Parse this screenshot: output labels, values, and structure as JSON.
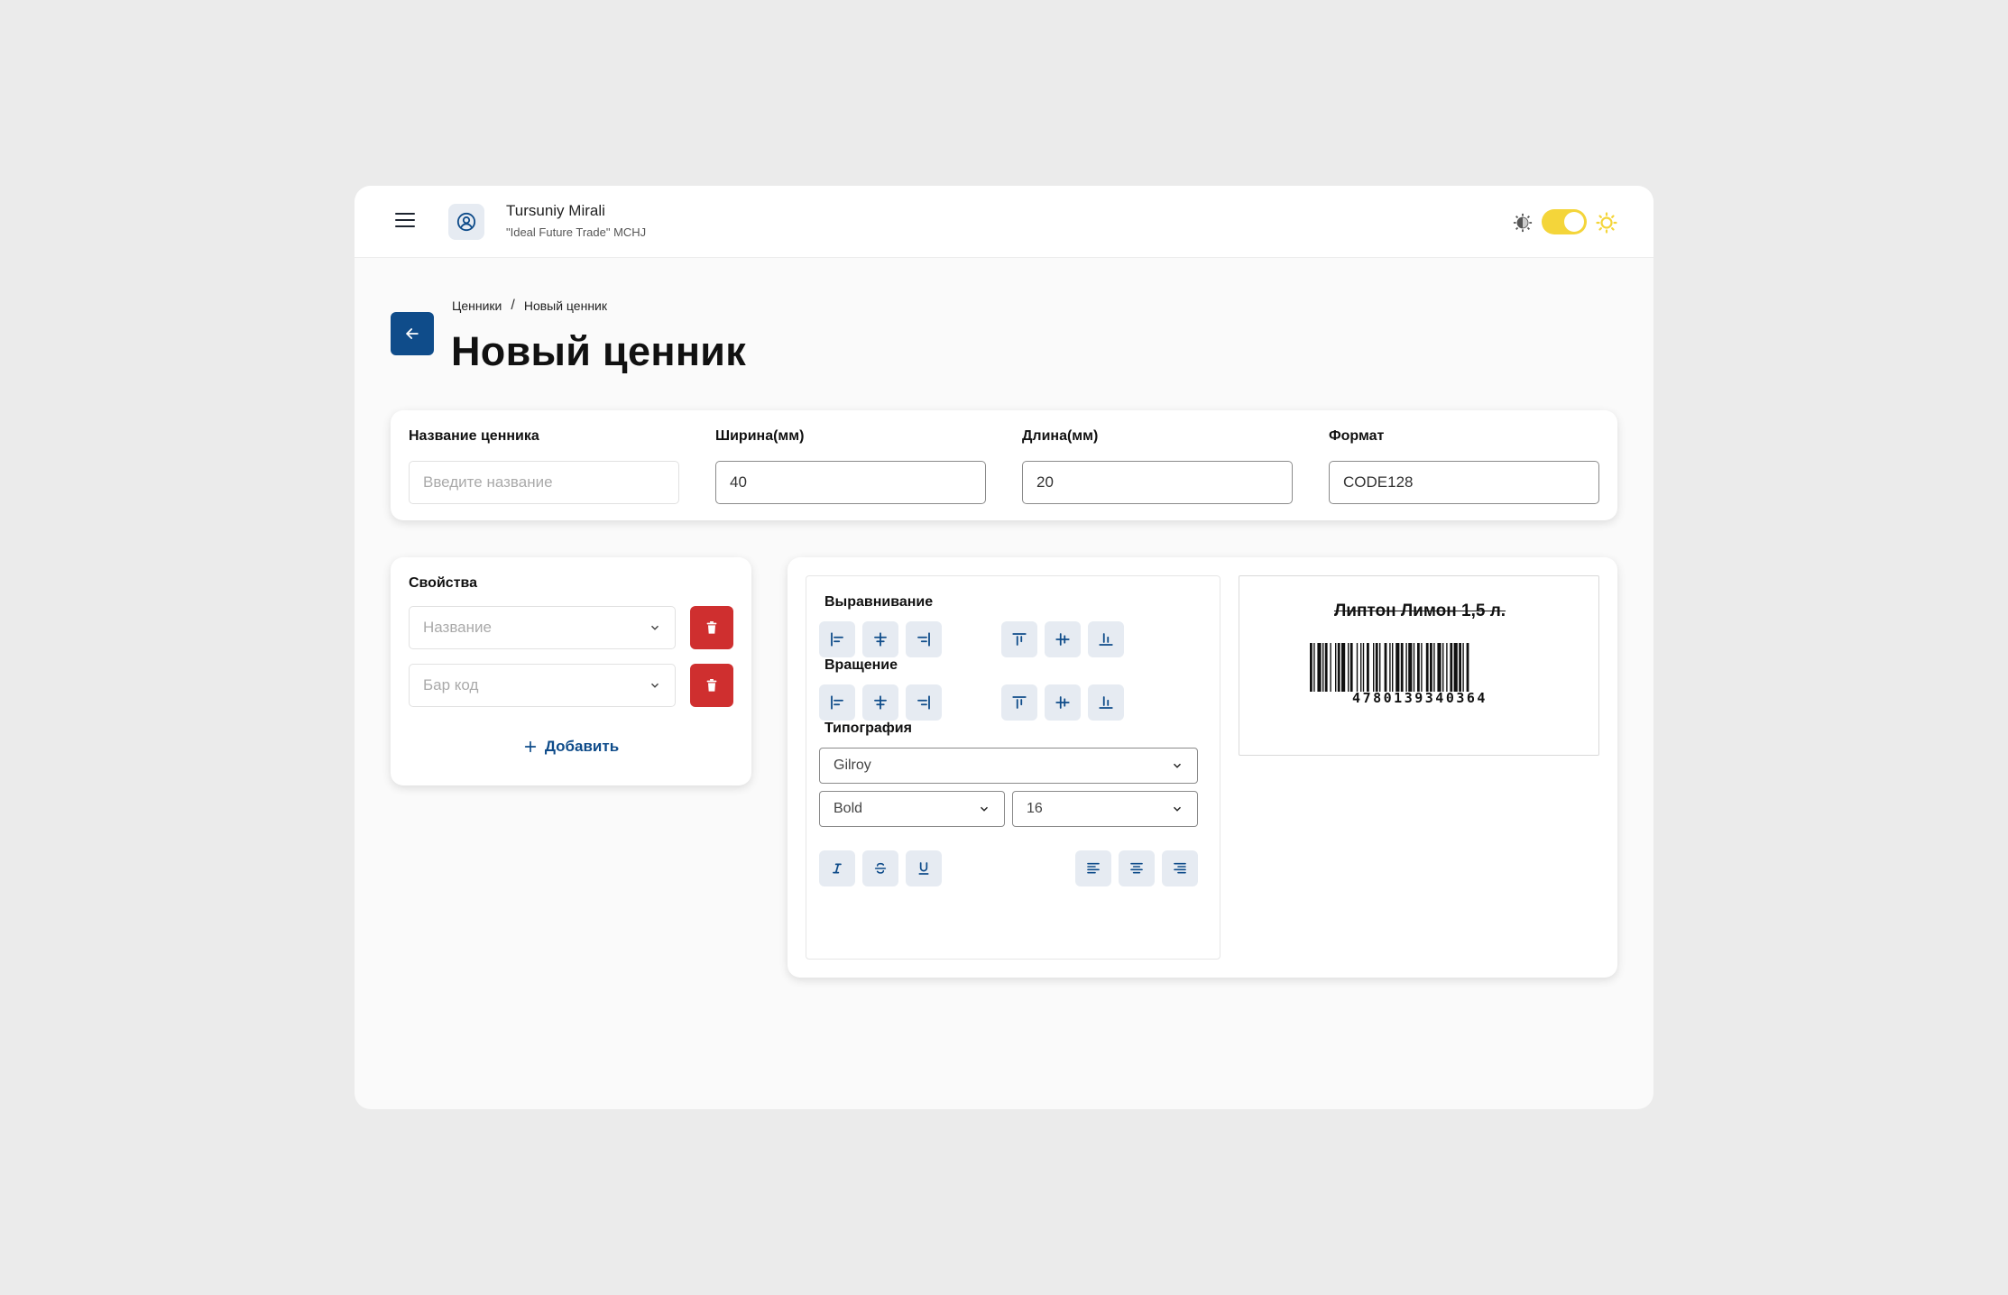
{
  "header": {
    "user_name": "Tursuniy Mirali",
    "company": "\"Ideal Future Trade\" MCHJ",
    "theme_toggle": "on",
    "toggle_color": "#f4d53a"
  },
  "breadcrumb": {
    "items": [
      "Ценники",
      "Новый ценник"
    ],
    "separator": "/"
  },
  "page": {
    "title": "Новый ценник"
  },
  "form": {
    "name_label": "Название ценника",
    "name_placeholder": "Введите название",
    "width_label": "Ширина(мм)",
    "width_value": "40",
    "length_label": "Длина(мм)",
    "length_value": "20",
    "format_label": "Формат",
    "format_value": "CODE128"
  },
  "properties": {
    "title": "Свойства",
    "items": [
      {
        "placeholder": "Название"
      },
      {
        "placeholder": "Бар код"
      }
    ],
    "add_label": "Добавить"
  },
  "editor": {
    "alignment_title": "Выравнивание",
    "rotation_title": "Вращение",
    "typography_title": "Типография",
    "font_family": "Gilroy",
    "font_weight": "Bold",
    "font_size": "16"
  },
  "preview": {
    "product_name": "Липтон Лимон 1,5 л.",
    "barcode_number": "4780139340364"
  },
  "colors": {
    "primary": "#0f4c8a",
    "danger": "#cf2f2f",
    "icon_button_bg": "#e6ebf2"
  }
}
